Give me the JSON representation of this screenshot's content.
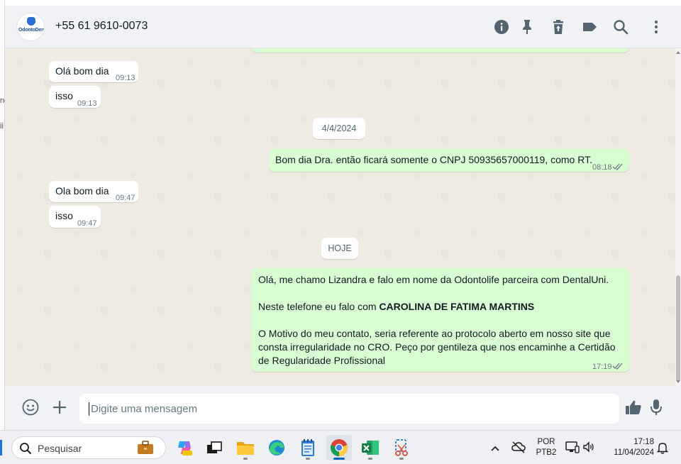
{
  "header": {
    "contact_name": "+55 61 9610-0073",
    "logo_text": "OdontoDente",
    "icons": [
      "info-icon",
      "pin-icon",
      "delete-icon",
      "label-icon",
      "search-icon",
      "menu-icon"
    ]
  },
  "left_fragments": [
    "ne",
    "ii"
  ],
  "messages": [
    {
      "dir": "in",
      "text": "Olá bom dia",
      "time": "09:13"
    },
    {
      "dir": "in",
      "text": "isso",
      "time": "09:13"
    },
    {
      "dir": "date",
      "text": "4/4/2024"
    },
    {
      "dir": "out",
      "text": "Bom dia Dra. então ficará somente o CNPJ 50935657000119, como RT.",
      "time": "08:18",
      "status": "read"
    },
    {
      "dir": "in",
      "text": "Ola bom dia",
      "time": "09:47"
    },
    {
      "dir": "in",
      "text": "isso",
      "time": "09:47"
    },
    {
      "dir": "date",
      "text": "HOJE"
    },
    {
      "dir": "out",
      "time": "17:19",
      "status": "read",
      "line1": "Olá, me chamo Lizandra e falo em nome da Odontolife parceira com DentalUni.",
      "line2_prefix": "Neste telefone eu falo com ",
      "line2_bold": "CAROLINA DE FATIMA MARTINS",
      "line3": "O Motivo do meu contato, seria referente ao protocolo aberto em nosso site que consta irregularidade no CRO. Peço por gentileza que nos encaminhe a Certidão de Regularidade Profissional"
    }
  ],
  "composer": {
    "placeholder": "Digite uma mensagem",
    "icons": [
      "emoji-icon",
      "plus-icon",
      "thumbs-up-icon",
      "microphone-icon"
    ]
  },
  "taskbar": {
    "search_label": "Pesquisar",
    "apps": [
      "copilot",
      "task-view",
      "file-explorer",
      "edge",
      "notepad",
      "chrome",
      "excel",
      "snipping-tool"
    ],
    "lang_top": "POR",
    "lang_bottom": "PTB2",
    "time": "17:18",
    "date": "11/04/2024"
  },
  "colors": {
    "incoming": "#ffffff",
    "outgoing": "#d9fdd3",
    "wallpaper": "#efeae2",
    "header": "#f0f2f5",
    "read_ticks": "#667781"
  }
}
